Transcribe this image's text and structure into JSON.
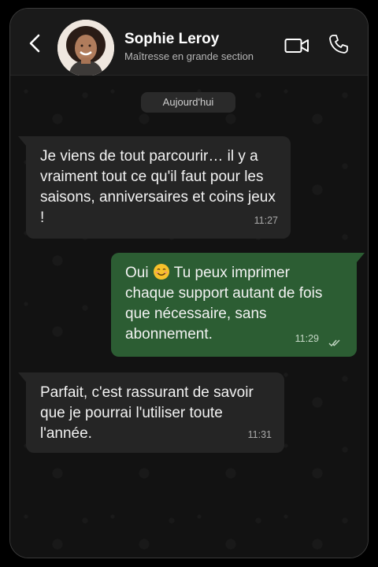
{
  "header": {
    "contact_name": "Sophie Leroy",
    "contact_status": "Maîtresse en grande section",
    "icons": [
      "back-arrow-icon",
      "video-camera-icon",
      "phone-icon"
    ]
  },
  "chat": {
    "date_label": "Aujourd'hui",
    "messages": [
      {
        "direction": "incoming",
        "text": "Je viens de tout parcourir… il y a vraiment tout ce qu'il faut pour les saisons, anniversaires et coins jeux !",
        "time": "11:27"
      },
      {
        "direction": "outgoing",
        "text_before_emoji": "Oui",
        "emoji": "smiling-face-emoji",
        "text_after_emoji": " Tu peux imprimer chaque support autant de fois que nécessaire, sans abonnement.",
        "time": "11:29",
        "read_status": "double-check-read"
      },
      {
        "direction": "incoming",
        "text": "Parfait, c'est rassurant de savoir que je pourrai l'utiliser toute l'année.",
        "time": "11:31"
      }
    ]
  },
  "colors": {
    "header_bg": "#1a1a1a",
    "chat_bg": "#121212",
    "incoming_bubble": "#252525",
    "outgoing_bubble": "#2c5d33",
    "text": "#f2f2f2"
  }
}
